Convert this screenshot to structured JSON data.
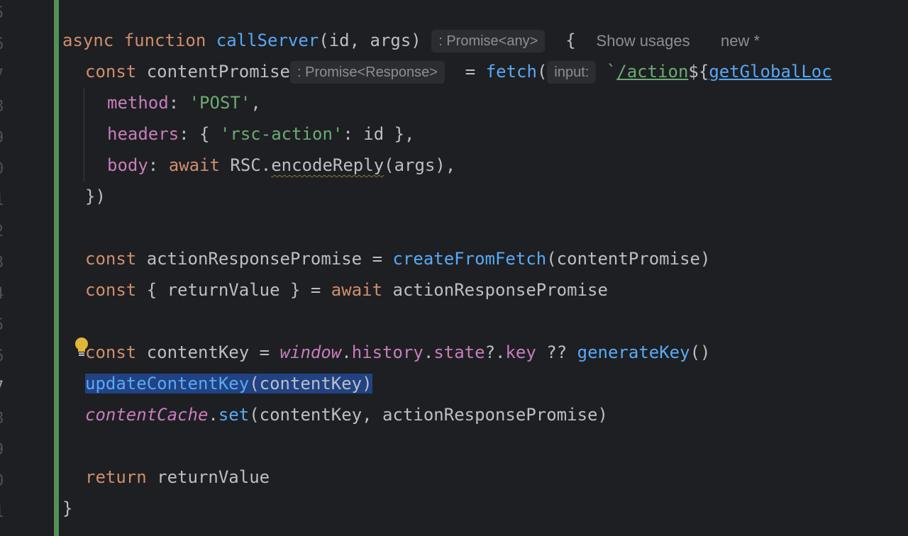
{
  "gutter": {
    "line_numbers": [
      "5",
      "6",
      "7",
      "8",
      "9",
      "0",
      "1",
      "2",
      "3",
      "4",
      "5",
      "6",
      "7",
      "8",
      "9",
      "0",
      "1"
    ]
  },
  "code": {
    "l6": {
      "async": "async",
      "function": "function",
      "name": "callServer",
      "params": "(id, args)",
      "hint_type": ": Promise<any>",
      "brace": "{",
      "show_usages": "Show usages",
      "new_marker": "new *"
    },
    "l7": {
      "const": "const",
      "var": "contentPromise",
      "hint_type": ": Promise<Response>",
      "eq": "= ",
      "fetch": "fetch",
      "paren": "(",
      "hint_param": "input:",
      "tick": "`",
      "path": "/action",
      "dollar": "${",
      "global_fn": "getGlobalLoc"
    },
    "l8": {
      "key": "method",
      "colon": ": ",
      "value": "'POST'",
      "comma": ","
    },
    "l9": {
      "key": "headers",
      "colon": ": { ",
      "str": "'rsc-action'",
      "rest": ": id },"
    },
    "l10": {
      "key": "body",
      "colon": ": ",
      "await": "await",
      "obj": " RSC.",
      "method": "encodeReply",
      "rest": "(args),"
    },
    "l11": {
      "text": "})"
    },
    "l13": {
      "const": "const",
      "var": " actionResponsePromise = ",
      "fn": "createFromFetch",
      "rest": "(contentPromise)"
    },
    "l14": {
      "const": "const",
      "mid": " { returnValue } = ",
      "await": "await",
      "rest": " actionResponsePromise"
    },
    "l16": {
      "const": "const",
      "mid": " contentKey = ",
      "window": "window",
      "dot1": ".",
      "history": "history",
      "dot2": ".",
      "state": "state",
      "opt": "?.",
      "key": "key",
      "nullish": " ?? ",
      "fn": "generateKey",
      "rest": "()"
    },
    "l17": {
      "fn": "updateContentKey",
      "rest": "(contentKey)"
    },
    "l18": {
      "obj": "contentCache",
      "dot": ".",
      "method": "set",
      "rest": "(contentKey, actionResponsePromise)"
    },
    "l20": {
      "return": "return",
      "rest": " returnValue"
    },
    "l21": {
      "text": "}"
    }
  },
  "colors": {
    "background": "#1e1f22",
    "keyword": "#cf8e6d",
    "function": "#56a8f5",
    "string": "#6aab73",
    "property": "#c77dbb",
    "change_bar": "#549159",
    "selection": "#214283"
  },
  "icons": {
    "intention": "lightbulb-icon"
  }
}
